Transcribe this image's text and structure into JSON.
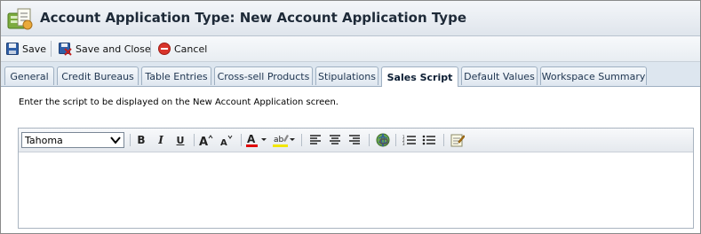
{
  "header": {
    "title": "Account Application Type: New Account Application Type",
    "icon": "account-application-icon"
  },
  "toolbar": {
    "save_label": "Save",
    "save_close_label": "Save and Close",
    "cancel_label": "Cancel"
  },
  "tabs": [
    {
      "label": "General",
      "active": false
    },
    {
      "label": "Credit Bureaus",
      "active": false
    },
    {
      "label": "Table Entries",
      "active": false
    },
    {
      "label": "Cross-sell Products",
      "active": false
    },
    {
      "label": "Stipulations",
      "active": false
    },
    {
      "label": "Sales Script",
      "active": true
    },
    {
      "label": "Default Values",
      "active": false
    },
    {
      "label": "Workspace Summary",
      "active": false
    }
  ],
  "content": {
    "instruction": "Enter the script to be displayed on the New Account Application screen."
  },
  "editor": {
    "font_value": "Tahoma",
    "bold_glyph": "B",
    "italic_glyph": "I",
    "underline_glyph": "U",
    "text": ""
  },
  "colors": {
    "font_color": "#e00000",
    "highlight_color": "#f2e600",
    "cancel_red": "#d9342b"
  }
}
